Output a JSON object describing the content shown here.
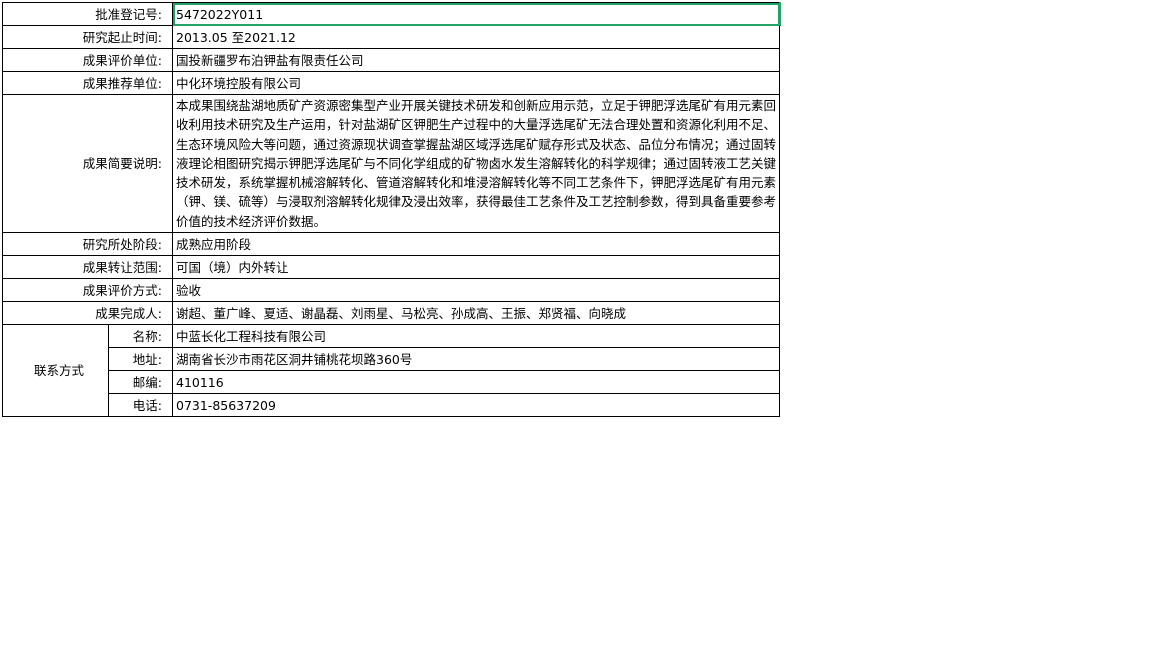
{
  "rows": [
    {
      "label": "批准登记号:",
      "value": "5472022Y011"
    },
    {
      "label": "研究起止时间:",
      "value": "2013.05  至2021.12"
    },
    {
      "label": "成果评价单位:",
      "value": "国投新疆罗布泊钾盐有限责任公司"
    },
    {
      "label": "成果推荐单位:",
      "value": "中化环境控股有限公司"
    },
    {
      "label": "成果简要说明:",
      "value": "本成果围绕盐湖地质矿产资源密集型产业开展关键技术研发和创新应用示范，立足于钾肥浮选尾矿有用元素回收利用技术研究及生产运用，针对盐湖矿区钾肥生产过程中的大量浮选尾矿无法合理处置和资源化利用不足、生态环境风险大等问题，通过资源现状调查掌握盐湖区域浮选尾矿赋存形式及状态、品位分布情况；通过固转液理论相图研究揭示钾肥浮选尾矿与不同化学组成的矿物卤水发生溶解转化的科学规律；通过固转液工艺关键技术研发，系统掌握机械溶解转化、管道溶解转化和堆浸溶解转化等不同工艺条件下，钾肥浮选尾矿有用元素（钾、镁、硫等）与浸取剂溶解转化规律及浸出效率，获得最佳工艺条件及工艺控制参数，得到具备重要参考价值的技术经济评价数据。"
    },
    {
      "label": "研究所处阶段:",
      "value": "成熟应用阶段"
    },
    {
      "label": "成果转让范围:",
      "value": "可国（境）内外转让"
    },
    {
      "label": "成果评价方式:",
      "value": "验收"
    },
    {
      "label": "成果完成人:",
      "value": "谢超、董广峰、夏适、谢晶磊、刘雨星、马松亮、孙成高、王振、郑贤福、向晓成"
    }
  ],
  "contact": {
    "group_label": "联系方式",
    "items": [
      {
        "label": "名称:",
        "value": "中蓝长化工程科技有限公司"
      },
      {
        "label": "地址:",
        "value": "湖南省长沙市雨花区洞井铺桃花坝路360号"
      },
      {
        "label": "邮编:",
        "value": "410116"
      },
      {
        "label": "电话:",
        "value": "0731-85637209"
      }
    ]
  },
  "colors": {
    "selection": "#21a366",
    "grid": "#000000"
  }
}
